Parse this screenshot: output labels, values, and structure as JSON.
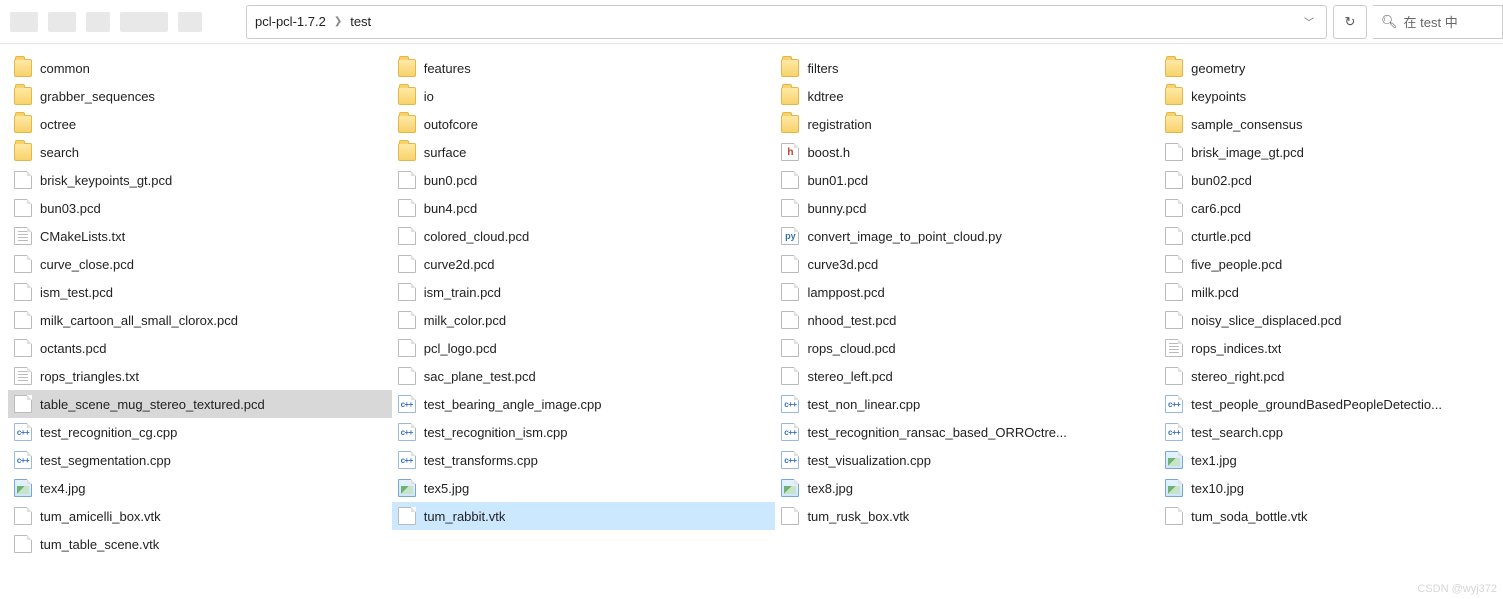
{
  "breadcrumb": {
    "a": "pcl-pcl-1.7.2",
    "b": "test"
  },
  "search": {
    "placeholder": "在 test 中"
  },
  "watermark": "CSDN @wyj372",
  "columns": [
    [
      {
        "t": "folder",
        "n": "common"
      },
      {
        "t": "folder",
        "n": "grabber_sequences"
      },
      {
        "t": "folder",
        "n": "octree"
      },
      {
        "t": "folder",
        "n": "search"
      },
      {
        "t": "file",
        "n": "brisk_keypoints_gt.pcd"
      },
      {
        "t": "file",
        "n": "bun03.pcd"
      },
      {
        "t": "txt",
        "n": "CMakeLists.txt"
      },
      {
        "t": "file",
        "n": "curve_close.pcd"
      },
      {
        "t": "file",
        "n": "ism_test.pcd"
      },
      {
        "t": "file",
        "n": "milk_cartoon_all_small_clorox.pcd"
      },
      {
        "t": "file",
        "n": "octants.pcd"
      },
      {
        "t": "txt",
        "n": "rops_triangles.txt"
      },
      {
        "t": "file",
        "n": "table_scene_mug_stereo_textured.pcd",
        "sel": "hover"
      },
      {
        "t": "cpp",
        "n": "test_recognition_cg.cpp"
      },
      {
        "t": "cpp",
        "n": "test_segmentation.cpp"
      },
      {
        "t": "jpg",
        "n": "tex4.jpg"
      },
      {
        "t": "file",
        "n": "tum_amicelli_box.vtk"
      },
      {
        "t": "file",
        "n": "tum_table_scene.vtk"
      }
    ],
    [
      {
        "t": "folder",
        "n": "features"
      },
      {
        "t": "folder",
        "n": "io"
      },
      {
        "t": "folder",
        "n": "outofcore"
      },
      {
        "t": "folder",
        "n": "surface"
      },
      {
        "t": "file",
        "n": "bun0.pcd"
      },
      {
        "t": "file",
        "n": "bun4.pcd"
      },
      {
        "t": "file",
        "n": "colored_cloud.pcd"
      },
      {
        "t": "file",
        "n": "curve2d.pcd"
      },
      {
        "t": "file",
        "n": "ism_train.pcd"
      },
      {
        "t": "file",
        "n": "milk_color.pcd"
      },
      {
        "t": "file",
        "n": "pcl_logo.pcd"
      },
      {
        "t": "file",
        "n": "sac_plane_test.pcd"
      },
      {
        "t": "cpp",
        "n": "test_bearing_angle_image.cpp"
      },
      {
        "t": "cpp",
        "n": "test_recognition_ism.cpp"
      },
      {
        "t": "cpp",
        "n": "test_transforms.cpp"
      },
      {
        "t": "jpg",
        "n": "tex5.jpg"
      },
      {
        "t": "file",
        "n": "tum_rabbit.vtk",
        "sel": "selected"
      }
    ],
    [
      {
        "t": "folder",
        "n": "filters"
      },
      {
        "t": "folder",
        "n": "kdtree"
      },
      {
        "t": "folder",
        "n": "registration"
      },
      {
        "t": "h",
        "n": "boost.h"
      },
      {
        "t": "file",
        "n": "bun01.pcd"
      },
      {
        "t": "file",
        "n": "bunny.pcd"
      },
      {
        "t": "py",
        "n": "convert_image_to_point_cloud.py"
      },
      {
        "t": "file",
        "n": "curve3d.pcd"
      },
      {
        "t": "file",
        "n": "lamppost.pcd"
      },
      {
        "t": "file",
        "n": "nhood_test.pcd"
      },
      {
        "t": "file",
        "n": "rops_cloud.pcd"
      },
      {
        "t": "file",
        "n": "stereo_left.pcd"
      },
      {
        "t": "cpp",
        "n": "test_non_linear.cpp"
      },
      {
        "t": "cpp",
        "n": "test_recognition_ransac_based_ORROctre..."
      },
      {
        "t": "cpp",
        "n": "test_visualization.cpp"
      },
      {
        "t": "jpg",
        "n": "tex8.jpg"
      },
      {
        "t": "file",
        "n": "tum_rusk_box.vtk"
      }
    ],
    [
      {
        "t": "folder",
        "n": "geometry"
      },
      {
        "t": "folder",
        "n": "keypoints"
      },
      {
        "t": "folder",
        "n": "sample_consensus"
      },
      {
        "t": "file",
        "n": "brisk_image_gt.pcd"
      },
      {
        "t": "file",
        "n": "bun02.pcd"
      },
      {
        "t": "file",
        "n": "car6.pcd"
      },
      {
        "t": "file",
        "n": "cturtle.pcd"
      },
      {
        "t": "file",
        "n": "five_people.pcd"
      },
      {
        "t": "file",
        "n": "milk.pcd"
      },
      {
        "t": "file",
        "n": "noisy_slice_displaced.pcd"
      },
      {
        "t": "txt",
        "n": "rops_indices.txt"
      },
      {
        "t": "file",
        "n": "stereo_right.pcd"
      },
      {
        "t": "cpp",
        "n": "test_people_groundBasedPeopleDetectio..."
      },
      {
        "t": "cpp",
        "n": "test_search.cpp"
      },
      {
        "t": "jpg",
        "n": "tex1.jpg"
      },
      {
        "t": "jpg",
        "n": "tex10.jpg"
      },
      {
        "t": "file",
        "n": "tum_soda_bottle.vtk"
      }
    ]
  ]
}
